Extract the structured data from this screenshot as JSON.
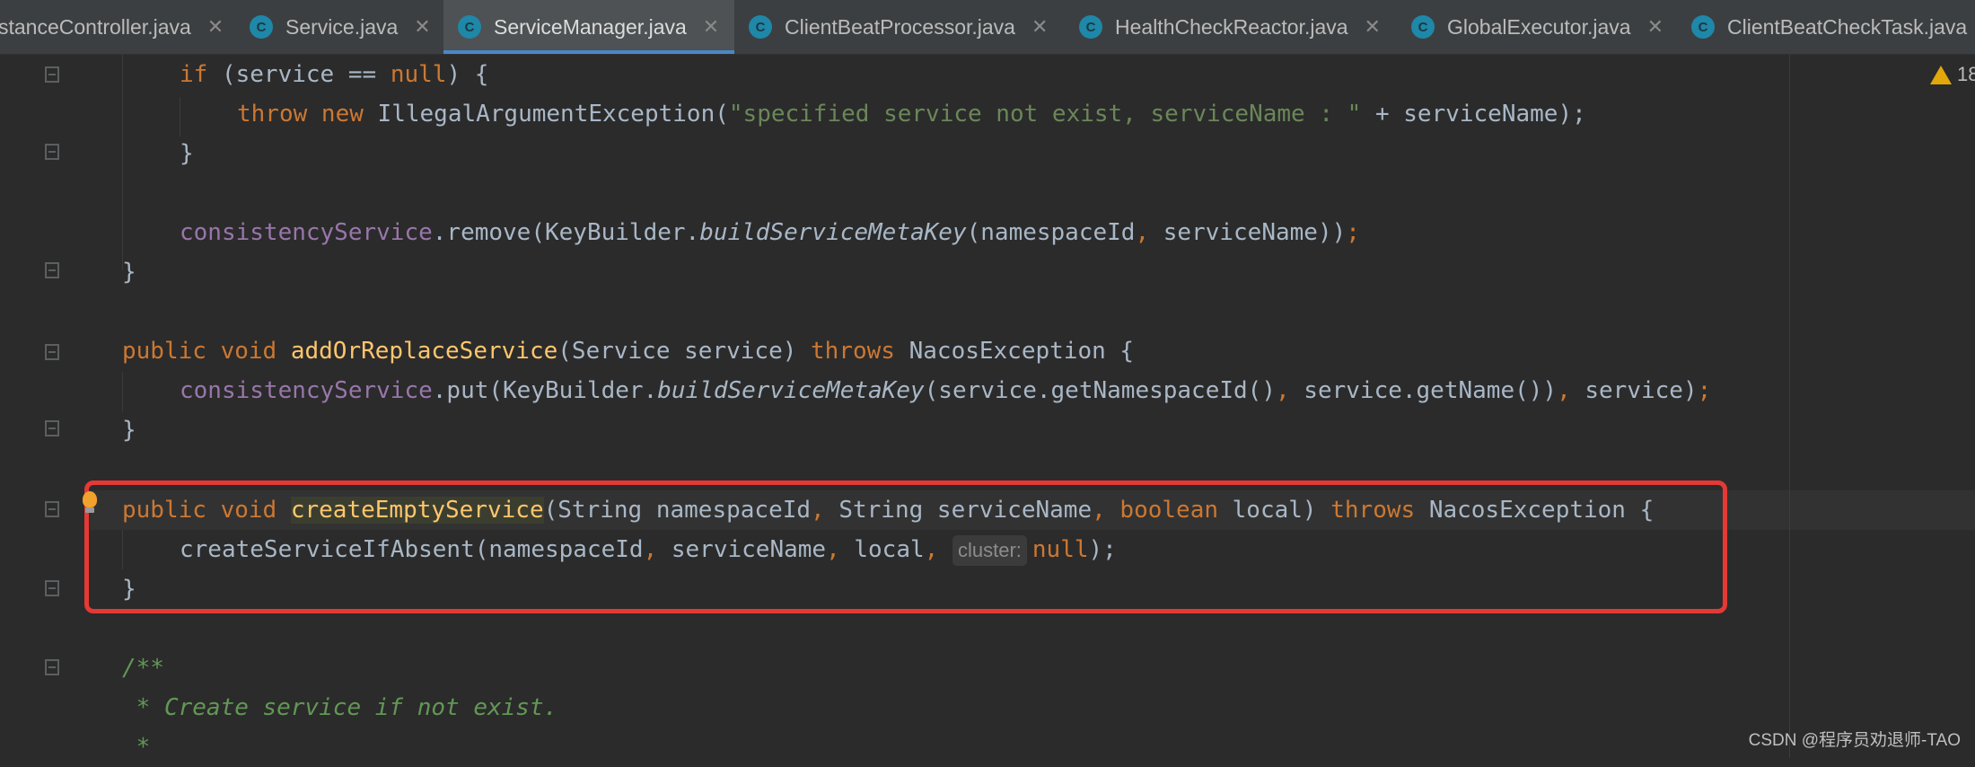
{
  "tabs": [
    {
      "label": "stanceController.java"
    },
    {
      "label": "Service.java"
    },
    {
      "label": "ServiceManager.java"
    },
    {
      "label": "ClientBeatProcessor.java"
    },
    {
      "label": "HealthCheckReactor.java"
    },
    {
      "label": "GlobalExecutor.java"
    },
    {
      "label": "ClientBeatCheckTask.java"
    }
  ],
  "active_tab": "ServiceManager.java",
  "tab_icon_letter": "C",
  "warnings": {
    "count": "18"
  },
  "code": {
    "l1": {
      "a": "if",
      "b": " (service == ",
      "c": "null",
      "d": ") {"
    },
    "l2": {
      "a": "throw new ",
      "b": "IllegalArgumentException(",
      "c": "\"specified service not exist, serviceName : \"",
      "d": " + serviceName);"
    },
    "l3": "}",
    "l4": {
      "a": "consistencyService",
      "b": ".remove(KeyBuilder.",
      "c": "buildServiceMetaKey",
      "d": "(namespaceId",
      "e": ", ",
      "f": "serviceName))",
      "g": ";"
    },
    "l5": "}",
    "l6": {
      "a": "public void ",
      "b": "addOrReplaceService",
      "c": "(Service service) ",
      "d": "throws ",
      "e": "NacosException {"
    },
    "l7": {
      "a": "consistencyService",
      "b": ".put(KeyBuilder.",
      "c": "buildServiceMetaKey",
      "d": "(service.getNamespaceId()",
      "e": ", ",
      "f": "service.getName())",
      "g": ", ",
      "h": "service)",
      "i": ";"
    },
    "l8": "}",
    "l9": {
      "a": "public void ",
      "b": "createEmptyService",
      "c": "(String namespaceId",
      "d": ", ",
      "e": "String serviceName",
      "f": ", ",
      "g": "boolean ",
      "h": "local) ",
      "i": "throws ",
      "j": "NacosException {"
    },
    "l10": {
      "a": "createServiceIfAbsent(namespaceId",
      "b": ", ",
      "c": "serviceName",
      "d": ", ",
      "e": "local",
      "f": ", ",
      "hint": "cluster:",
      "g": "null",
      "h": ");"
    },
    "l11": "}",
    "l12": "/**",
    "l13": " * Create service if not exist.",
    "l14": " *"
  },
  "watermark": "CSDN @程序员劝退师-TAO",
  "colors": {
    "keyword": "#cc7832",
    "string": "#6a8759",
    "field": "#9876aa",
    "method": "#ffc66d",
    "highlight_box": "#e53935"
  }
}
